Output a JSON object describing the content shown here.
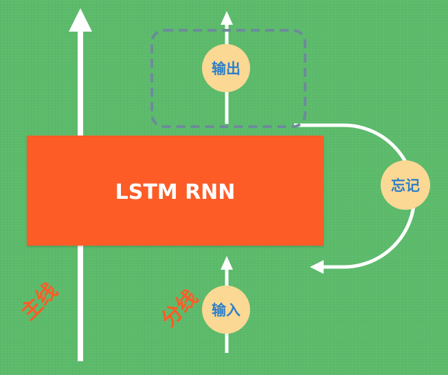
{
  "diagram": {
    "box_title": "LSTM RNN",
    "gates": {
      "output": "输出",
      "forget": "忘记",
      "input": "输入"
    },
    "lines": {
      "main": "主线",
      "branch": "分线"
    }
  },
  "colors": {
    "background": "#5cbb6b",
    "box": "#fd5c27",
    "gate_fill": "#fbd894",
    "gate_text": "#2f7fc7",
    "arrow": "#ffffff",
    "dashed_frame": "#6d8a9a"
  }
}
